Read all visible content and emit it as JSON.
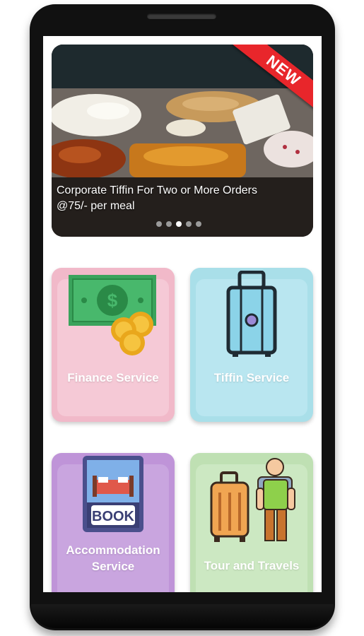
{
  "banner": {
    "caption_line1": "Corporate Tiffin For Two or More Orders",
    "caption_line2": "@75/- per meal",
    "ribbon": "NEW",
    "dots_count": 5,
    "active_dot": 3
  },
  "services": [
    {
      "label": "Finance Service",
      "icon": "money-coins-icon",
      "color": "#f5c9d6"
    },
    {
      "label": "Tiffin Service",
      "icon": "luggage-icon",
      "color": "#b9e6f0"
    },
    {
      "label_line1": "Accommodation",
      "label_line2": "Service",
      "icon": "book-room-icon",
      "color": "#c9a5df"
    },
    {
      "label": "Tour and Travels",
      "icon": "traveler-icon",
      "color": "#cce8c2"
    }
  ],
  "book_sign": "BOOK"
}
